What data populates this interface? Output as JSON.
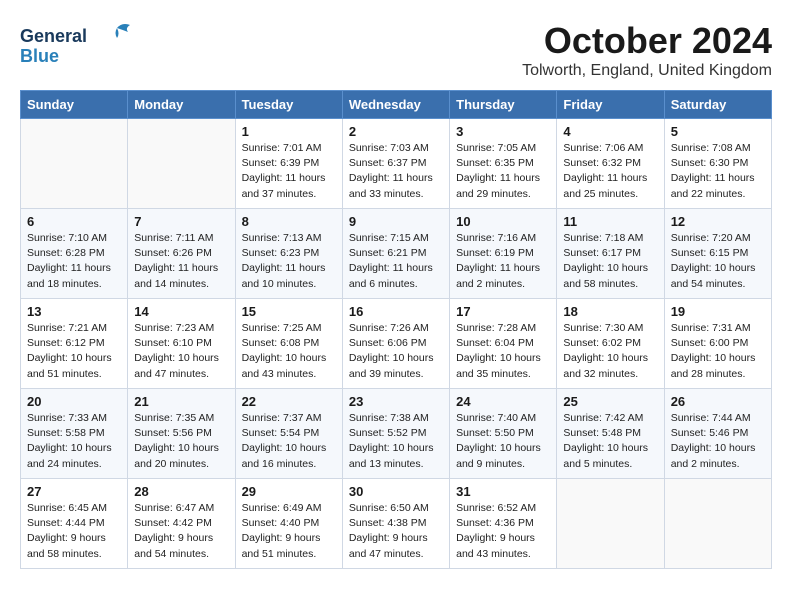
{
  "logo": {
    "line1": "General",
    "line2": "Blue"
  },
  "title": "October 2024",
  "location": "Tolworth, England, United Kingdom",
  "days_of_week": [
    "Sunday",
    "Monday",
    "Tuesday",
    "Wednesday",
    "Thursday",
    "Friday",
    "Saturday"
  ],
  "weeks": [
    [
      {
        "day": "",
        "content": ""
      },
      {
        "day": "",
        "content": ""
      },
      {
        "day": "1",
        "content": "Sunrise: 7:01 AM\nSunset: 6:39 PM\nDaylight: 11 hours and 37 minutes."
      },
      {
        "day": "2",
        "content": "Sunrise: 7:03 AM\nSunset: 6:37 PM\nDaylight: 11 hours and 33 minutes."
      },
      {
        "day": "3",
        "content": "Sunrise: 7:05 AM\nSunset: 6:35 PM\nDaylight: 11 hours and 29 minutes."
      },
      {
        "day": "4",
        "content": "Sunrise: 7:06 AM\nSunset: 6:32 PM\nDaylight: 11 hours and 25 minutes."
      },
      {
        "day": "5",
        "content": "Sunrise: 7:08 AM\nSunset: 6:30 PM\nDaylight: 11 hours and 22 minutes."
      }
    ],
    [
      {
        "day": "6",
        "content": "Sunrise: 7:10 AM\nSunset: 6:28 PM\nDaylight: 11 hours and 18 minutes."
      },
      {
        "day": "7",
        "content": "Sunrise: 7:11 AM\nSunset: 6:26 PM\nDaylight: 11 hours and 14 minutes."
      },
      {
        "day": "8",
        "content": "Sunrise: 7:13 AM\nSunset: 6:23 PM\nDaylight: 11 hours and 10 minutes."
      },
      {
        "day": "9",
        "content": "Sunrise: 7:15 AM\nSunset: 6:21 PM\nDaylight: 11 hours and 6 minutes."
      },
      {
        "day": "10",
        "content": "Sunrise: 7:16 AM\nSunset: 6:19 PM\nDaylight: 11 hours and 2 minutes."
      },
      {
        "day": "11",
        "content": "Sunrise: 7:18 AM\nSunset: 6:17 PM\nDaylight: 10 hours and 58 minutes."
      },
      {
        "day": "12",
        "content": "Sunrise: 7:20 AM\nSunset: 6:15 PM\nDaylight: 10 hours and 54 minutes."
      }
    ],
    [
      {
        "day": "13",
        "content": "Sunrise: 7:21 AM\nSunset: 6:12 PM\nDaylight: 10 hours and 51 minutes."
      },
      {
        "day": "14",
        "content": "Sunrise: 7:23 AM\nSunset: 6:10 PM\nDaylight: 10 hours and 47 minutes."
      },
      {
        "day": "15",
        "content": "Sunrise: 7:25 AM\nSunset: 6:08 PM\nDaylight: 10 hours and 43 minutes."
      },
      {
        "day": "16",
        "content": "Sunrise: 7:26 AM\nSunset: 6:06 PM\nDaylight: 10 hours and 39 minutes."
      },
      {
        "day": "17",
        "content": "Sunrise: 7:28 AM\nSunset: 6:04 PM\nDaylight: 10 hours and 35 minutes."
      },
      {
        "day": "18",
        "content": "Sunrise: 7:30 AM\nSunset: 6:02 PM\nDaylight: 10 hours and 32 minutes."
      },
      {
        "day": "19",
        "content": "Sunrise: 7:31 AM\nSunset: 6:00 PM\nDaylight: 10 hours and 28 minutes."
      }
    ],
    [
      {
        "day": "20",
        "content": "Sunrise: 7:33 AM\nSunset: 5:58 PM\nDaylight: 10 hours and 24 minutes."
      },
      {
        "day": "21",
        "content": "Sunrise: 7:35 AM\nSunset: 5:56 PM\nDaylight: 10 hours and 20 minutes."
      },
      {
        "day": "22",
        "content": "Sunrise: 7:37 AM\nSunset: 5:54 PM\nDaylight: 10 hours and 16 minutes."
      },
      {
        "day": "23",
        "content": "Sunrise: 7:38 AM\nSunset: 5:52 PM\nDaylight: 10 hours and 13 minutes."
      },
      {
        "day": "24",
        "content": "Sunrise: 7:40 AM\nSunset: 5:50 PM\nDaylight: 10 hours and 9 minutes."
      },
      {
        "day": "25",
        "content": "Sunrise: 7:42 AM\nSunset: 5:48 PM\nDaylight: 10 hours and 5 minutes."
      },
      {
        "day": "26",
        "content": "Sunrise: 7:44 AM\nSunset: 5:46 PM\nDaylight: 10 hours and 2 minutes."
      }
    ],
    [
      {
        "day": "27",
        "content": "Sunrise: 6:45 AM\nSunset: 4:44 PM\nDaylight: 9 hours and 58 minutes."
      },
      {
        "day": "28",
        "content": "Sunrise: 6:47 AM\nSunset: 4:42 PM\nDaylight: 9 hours and 54 minutes."
      },
      {
        "day": "29",
        "content": "Sunrise: 6:49 AM\nSunset: 4:40 PM\nDaylight: 9 hours and 51 minutes."
      },
      {
        "day": "30",
        "content": "Sunrise: 6:50 AM\nSunset: 4:38 PM\nDaylight: 9 hours and 47 minutes."
      },
      {
        "day": "31",
        "content": "Sunrise: 6:52 AM\nSunset: 4:36 PM\nDaylight: 9 hours and 43 minutes."
      },
      {
        "day": "",
        "content": ""
      },
      {
        "day": "",
        "content": ""
      }
    ]
  ]
}
